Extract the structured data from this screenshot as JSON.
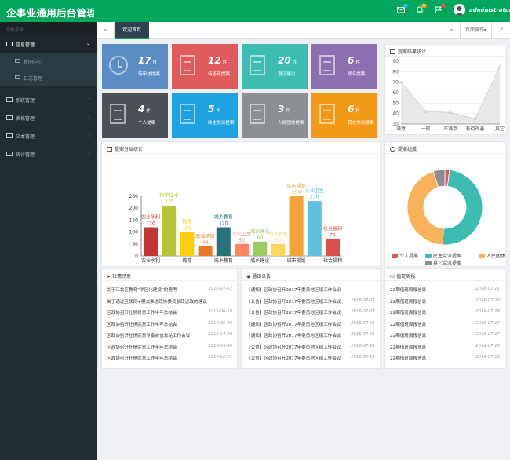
{
  "header": {
    "title": "企事业通用后台管理模",
    "mail_badge": "6",
    "bell_badge": "10",
    "flag_badge": "9",
    "username": "administrator"
  },
  "sidebar": {
    "nav_header": "导航菜单",
    "menus": [
      {
        "label": "信息管理",
        "open": true
      },
      {
        "label": "系统管理"
      },
      {
        "label": "表格管理"
      },
      {
        "label": "文本管理"
      },
      {
        "label": "统计管理"
      }
    ],
    "submenu": [
      "新闻中心",
      "日志管理"
    ]
  },
  "tabbar": {
    "prev": "«",
    "active_tab": "欢迎首页",
    "next": "»",
    "page_ops": "页面操作",
    "full": "⤢"
  },
  "tiles": [
    {
      "num": "17",
      "unit": "件",
      "label": "待审核提案",
      "color": "#5b8cc3",
      "icon": "clock"
    },
    {
      "num": "12",
      "unit": "件",
      "label": "待答审提案",
      "color": "#e05b5b",
      "icon": "doc"
    },
    {
      "num": "20",
      "unit": "件",
      "label": "意见建议",
      "color": "#3dbdb1",
      "icon": "doc"
    },
    {
      "num": "6",
      "unit": "件",
      "label": "联名提案",
      "color": "#8c6fb0",
      "icon": "doc"
    },
    {
      "num": "4",
      "unit": "件",
      "label": "个人提案",
      "color": "#4b5157",
      "icon": "doc"
    },
    {
      "num": "5",
      "unit": "件",
      "label": "民主党派提案",
      "color": "#1ea3e0",
      "icon": "doc"
    },
    {
      "num": "3",
      "unit": "件",
      "label": "人民团体提案",
      "color": "#8a8f94",
      "icon": "doc"
    },
    {
      "num": "6",
      "unit": "件",
      "label": "其它党派提案",
      "color": "#f29a16",
      "icon": "doc"
    }
  ],
  "panels": {
    "result_title": "提案结果统计",
    "category_title": "提案分类统计",
    "composition_title": "提案组成",
    "social_title": "社情民意",
    "notice_title": "通知公告",
    "weekly_title": "值班周报"
  },
  "chart_data": [
    {
      "type": "area",
      "name": "提案结果统计",
      "categories": [
        "满意",
        "一般",
        "不满意",
        "有待改善",
        "其它"
      ],
      "values": [
        70,
        42,
        41,
        35,
        85
      ],
      "ylim": [
        30,
        90
      ],
      "yticks": [
        30,
        40,
        50,
        60,
        70,
        80,
        90
      ]
    },
    {
      "type": "bar",
      "name": "提案分类统计",
      "categories": [
        "农业水利",
        "科学技术",
        "教育",
        "政治法律",
        "城乡教育",
        "公交卫生",
        "城乡建设",
        "经济发展",
        "城市规划",
        "公共卫生",
        "社会福利"
      ],
      "axis_labels": [
        "农业水利",
        "教育",
        "城乡教育",
        "城乡建设",
        "城市规划",
        "社会福利"
      ],
      "values": [
        120,
        210,
        100,
        40,
        120,
        50,
        60,
        50,
        250,
        230,
        70
      ],
      "colors": [
        "#c23531",
        "#b5c334",
        "#fcce10",
        "#e87c25",
        "#27727b",
        "#fe8463",
        "#9bca63",
        "#fad860",
        "#f3a43b",
        "#60c0dd",
        "#d7504b"
      ],
      "ylim": [
        0,
        250
      ],
      "yticks": [
        0,
        50,
        100,
        150,
        200,
        250
      ]
    },
    {
      "type": "pie",
      "name": "提案组成",
      "labels": [
        "个人提案",
        "民主党派提案",
        "人民团体",
        "其它党派提案"
      ],
      "values": [
        2,
        49,
        44,
        5
      ],
      "colors": [
        "#e05b5b",
        "#3dbdb1",
        "#f7b25a",
        "#8a8f94"
      ]
    }
  ],
  "social_list": [
    {
      "t": "关于江北区教育“学区化建设”的思考",
      "d": "2016-07-02"
    },
    {
      "t": "关于通过互联网+模式推进政协委员参政议政的建议",
      "d": ""
    },
    {
      "t": "区政协召开社情民意工作半年总结会",
      "d": "2016-06-18"
    },
    {
      "t": "区政协召开社情民意工作半年总结会",
      "d": "2016-06-26"
    },
    {
      "t": "区政协召开社情民意专委会信息站工作会议",
      "d": "2016-04-20"
    },
    {
      "t": "区政协召开社情民意工作半年总结会",
      "d": "2016-03-08"
    },
    {
      "t": "区政协召开社情民意工作半年总结会",
      "d": "2016-02-22"
    }
  ],
  "notice_list": [
    {
      "t": "【通知】区政协召开2017年委员地区组工作会议",
      "d": ""
    },
    {
      "t": "【公告】区政协召开2017年委员地区组工作会议",
      "d": "2016-07-21"
    },
    {
      "t": "【公告】区政协召开2017年委员地区组工作会议",
      "d": "2016-07-21"
    },
    {
      "t": "【通知】区政协召开2017年委员地区组工作会议",
      "d": "2016-07-21"
    },
    {
      "t": "【通知】区政协召开2017年委员地区组工作会议",
      "d": "2016-07-21"
    },
    {
      "t": "【公告】区政协召开2017年委员地区组工作会议",
      "d": "2016-07-21"
    },
    {
      "t": "【公告】区政协召开2017年委员地区组工作会议",
      "d": "2016-07-21"
    }
  ],
  "weekly_list": [
    {
      "t": "22期值班周报信息",
      "d": "2016-07-21"
    },
    {
      "t": "22期值班周报信息",
      "d": "2016-07-20"
    },
    {
      "t": "22期值班周报信息",
      "d": "2016-07-19"
    },
    {
      "t": "22期值班周报信息",
      "d": "2016-07-17"
    },
    {
      "t": "22期值班周报信息",
      "d": "2016-07-17"
    },
    {
      "t": "22期值班周报信息",
      "d": "2016-07-15"
    },
    {
      "t": "22期值班周报信息",
      "d": "2016-07-12"
    }
  ],
  "colors": {
    "header": "#00a65a",
    "sidebar": "#222d32",
    "tab_active": "#2f4050"
  }
}
